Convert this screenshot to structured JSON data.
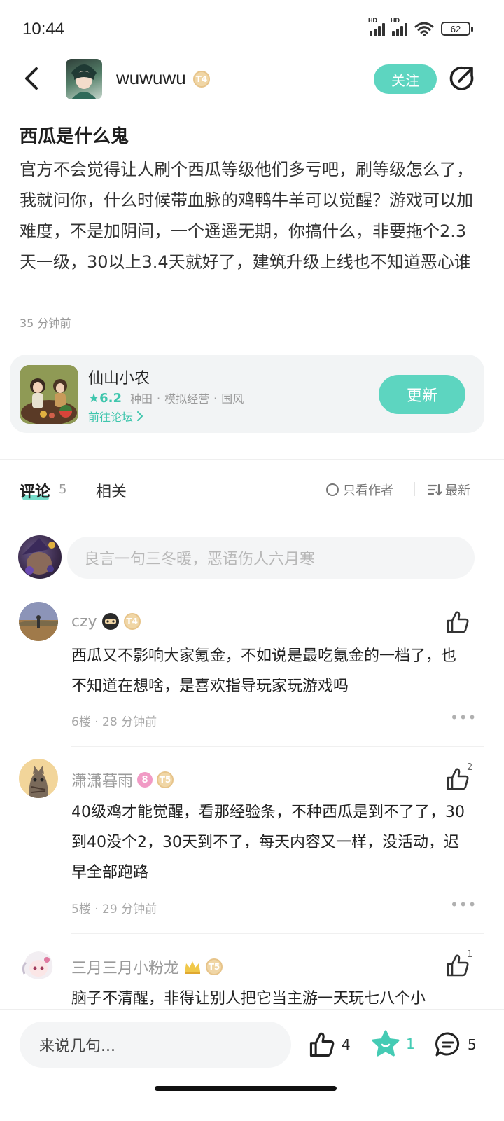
{
  "status": {
    "time": "10:44",
    "battery": "62",
    "hd1": "HD",
    "hd2": "HD"
  },
  "header": {
    "username": "wuwuwu",
    "level": "T4",
    "follow_label": "关注"
  },
  "post": {
    "title": "西瓜是什么鬼",
    "body": "官方不会觉得让人刷个西瓜等级他们多亏吧，刷等级怎么了，我就问你，什么时候带血脉的鸡鸭牛羊可以觉醒？游戏可以加难度，不是加阴间，一个遥遥无期，你搞什么，非要拖个2.3天一级，30以上3.4天就好了，建筑升级上线也不知道恶心谁",
    "time": "35 分钟前"
  },
  "game": {
    "name": "仙山小农",
    "rating": "6.2",
    "tags": [
      "种田",
      "模拟经营",
      "国风"
    ],
    "link_label": "前往论坛",
    "update_label": "更新"
  },
  "tabs": {
    "comments_label": "评论",
    "comments_count": "5",
    "related_label": "相关",
    "author_only_label": "只看作者",
    "sort_label": "最新"
  },
  "comment_input": {
    "placeholder": "良言一句三冬暖，恶语伤人六月寒"
  },
  "comments": [
    {
      "name": "czy",
      "level": "T4",
      "text": "西瓜又不影响大家氪金，不如说是最吃氪金的一档了，也不知道在想啥，是喜欢指导玩家玩游戏吗",
      "floor": "6楼",
      "time": "28 分钟前",
      "likes": ""
    },
    {
      "name": "潇潇暮雨",
      "level": "T5",
      "badge": "8",
      "text": "40级鸡才能觉醒，看那经验条，不种西瓜是到不了了，30到40没个2，30天到不了，每天内容又一样，没活动，迟早全部跑路",
      "floor": "5楼",
      "time": "29 分钟前",
      "likes": "2"
    },
    {
      "name": "三月三月小粉龙",
      "level": "T5",
      "text": "脑子不清醒，非得让别人把它当主游一天玩七八个小",
      "likes": "1"
    }
  ],
  "bottom": {
    "input_placeholder": "来说几句...",
    "like_count": "4",
    "star_count": "1",
    "comment_count": "5"
  },
  "colors": {
    "accent": "#5dd5c0",
    "accent_text": "#3fc6ad"
  }
}
